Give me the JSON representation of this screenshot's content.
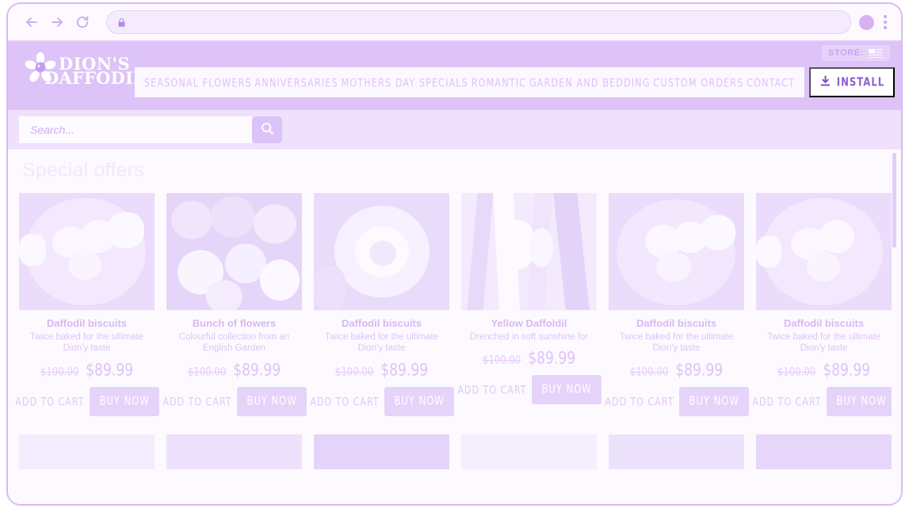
{
  "browser": {
    "back_icon": "back-arrow-icon",
    "forward_icon": "forward-arrow-icon",
    "reload_icon": "reload-icon",
    "lock_icon": "lock-icon",
    "address_value": "",
    "address_placeholder": "",
    "profile_icon": "profile-avatar-icon",
    "menu_icon": "kebab-menu-icon"
  },
  "header": {
    "logo": {
      "line1": "DION'S",
      "line2": "DAFFODILS.",
      "icon": "daffodil-flower-icon"
    },
    "store_locale": {
      "label": "STORE:",
      "flag_icon": "us-flag-icon"
    },
    "nav": [
      {
        "label": "SEASONAL FLOWERS"
      },
      {
        "label": "ANNIVERSARIES"
      },
      {
        "label": "MOTHERS DAY SPECIALS"
      },
      {
        "label": "ROMANTIC"
      },
      {
        "label": "GARDEN AND BEDDING"
      },
      {
        "label": "CUSTOM ORDERS"
      },
      {
        "label": "CONTACT"
      }
    ],
    "install": {
      "label": "INSTALL",
      "icon": "download-icon"
    }
  },
  "search": {
    "value": "",
    "placeholder": "Search...",
    "button_icon": "search-icon"
  },
  "main": {
    "section_title": "Special offers",
    "add_to_cart_label": "ADD TO CART",
    "buy_now_label": "BUY NOW",
    "products": [
      {
        "title": "Daffodil biscuits",
        "description": "Twice baked for the ultimate Dion'y taste",
        "price_old": "$100.00",
        "price_new": "$89.99",
        "image_alt": "daffodil-biscuits-plate-photo"
      },
      {
        "title": "Bunch of flowers",
        "description": "Colourful collection from an English Garden",
        "price_old": "$100.00",
        "price_new": "$89.99",
        "image_alt": "bunch-of-flowers-photo"
      },
      {
        "title": "Daffodil biscuits",
        "description": "Twice baked for the ultimate Dion'y taste",
        "price_old": "$100.00",
        "price_new": "$89.99",
        "image_alt": "rose-closeup-photo"
      },
      {
        "title": "Yellow Daffoldil",
        "description": "Drenched in soft sunshine for",
        "price_old": "$100.00",
        "price_new": "$89.99",
        "image_alt": "yellow-daffodil-photo"
      },
      {
        "title": "Daffodil biscuits",
        "description": "Twice baked for the ultimate Dion'y taste",
        "price_old": "$100.00",
        "price_new": "$89.99",
        "image_alt": "daffodil-biscuits-plate-photo"
      },
      {
        "title": "Daffodil biscuits",
        "description": "Twice baked for the ultimate Dion'y taste",
        "price_old": "$100.00",
        "price_new": "$89.99",
        "image_alt": "daffodil-biscuits-plate-photo"
      }
    ],
    "second_row_count": 6
  },
  "colors": {
    "header_band": "#ddc3f7",
    "search_band": "#efe1fc",
    "page_bg": "#fdfaff",
    "accent": "#8d5fd3",
    "text_lavender": "#d7b9f3",
    "button_fill": "#e6d3fa"
  }
}
